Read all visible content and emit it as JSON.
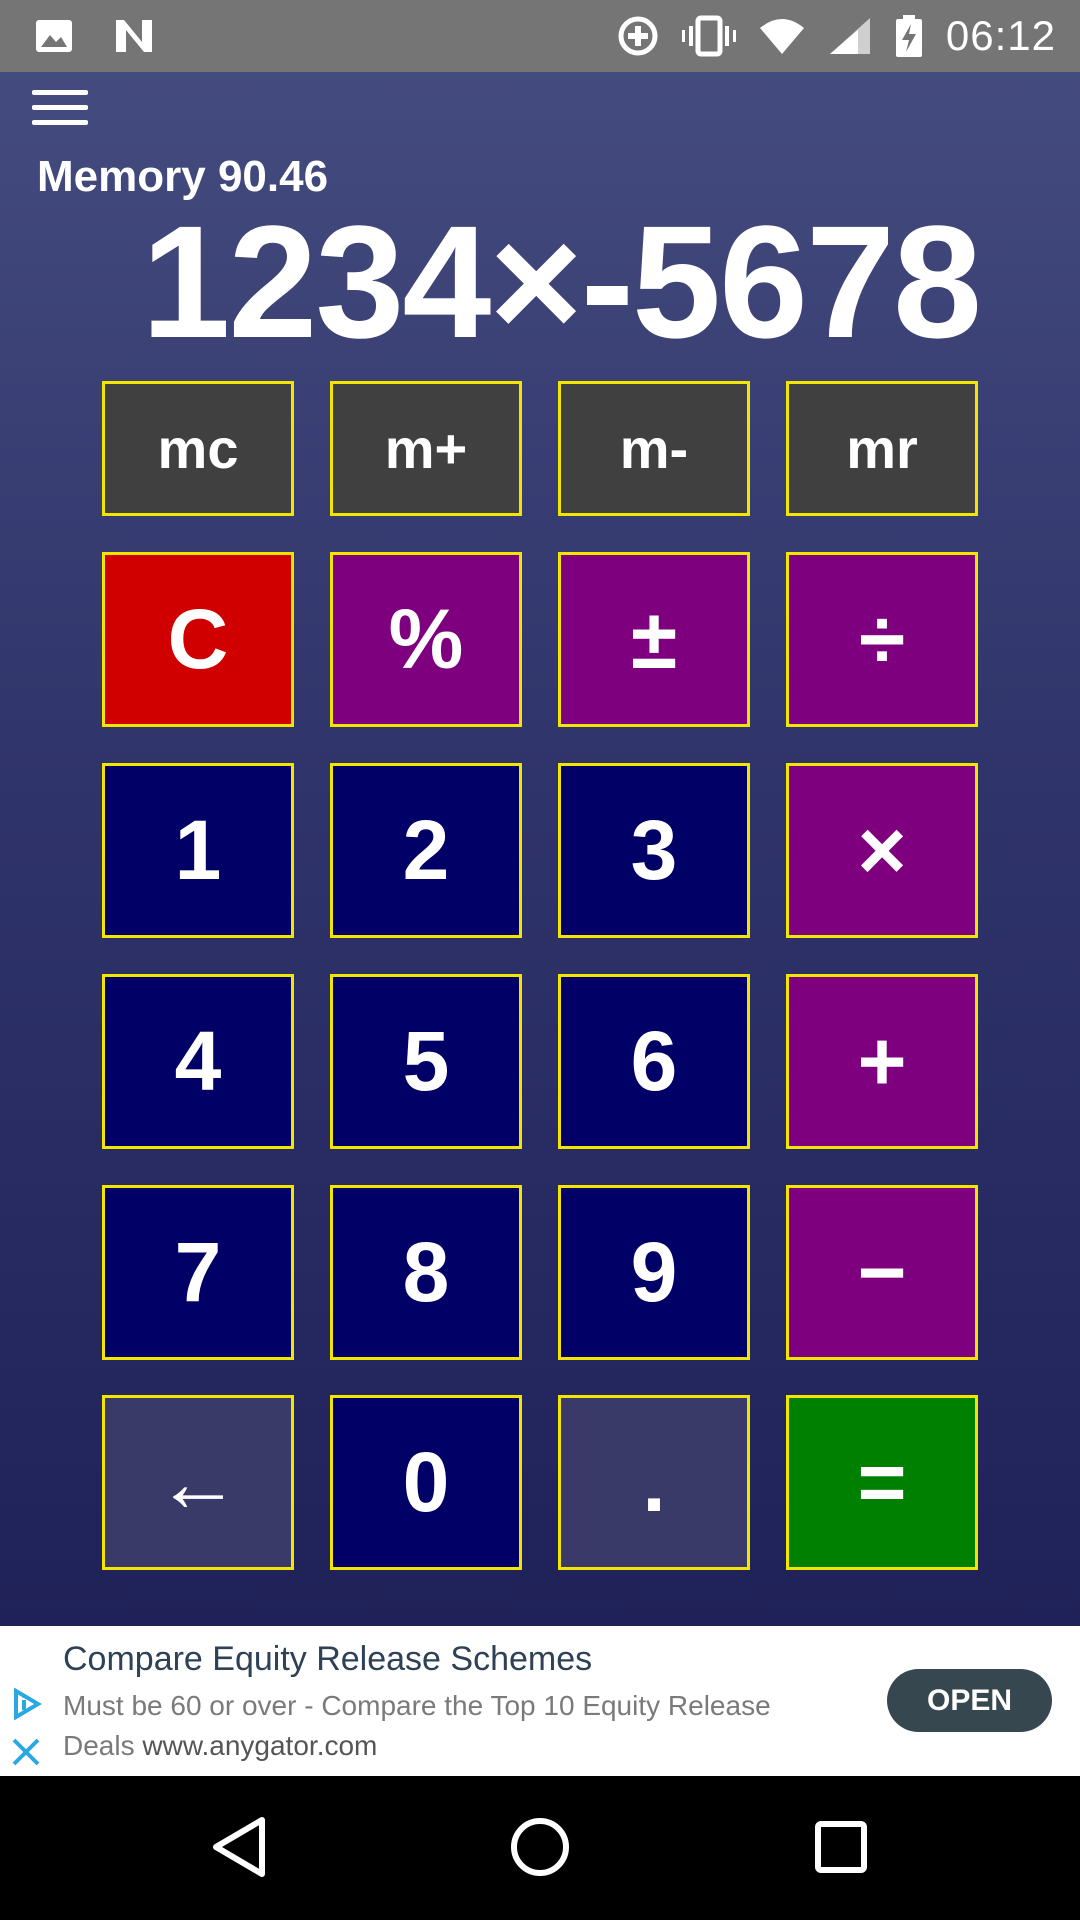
{
  "status_bar": {
    "time": "06:12",
    "icons": [
      "image-icon",
      "n-logo-icon",
      "data-saver-icon",
      "vibrate-icon",
      "wifi-icon",
      "signal-icon",
      "battery-charging-icon"
    ]
  },
  "app": {
    "memory_label": "Memory 90.46",
    "display": "1234×-5678",
    "menu_icon": "hamburger-menu-icon"
  },
  "keypad": {
    "memory_keys": [
      "mc",
      "m+",
      "m-",
      "mr"
    ],
    "rows": [
      [
        "C",
        "%",
        "±",
        "÷"
      ],
      [
        "1",
        "2",
        "3",
        "×"
      ],
      [
        "4",
        "5",
        "6",
        "+"
      ],
      [
        "7",
        "8",
        "9",
        "−"
      ],
      [
        "←",
        "0",
        ".",
        "="
      ]
    ]
  },
  "ad": {
    "title": "Compare Equity Release Schemes",
    "body": "Must be 60 or over - Compare the Top 10 Equity Release Deals",
    "url": "www.anygator.com",
    "cta": "OPEN"
  },
  "colors": {
    "key_border": "#f2e600",
    "clear": "#d00000",
    "operator": "#7f007f",
    "number": "#000066",
    "equals": "#008000",
    "memory": "#404040"
  }
}
